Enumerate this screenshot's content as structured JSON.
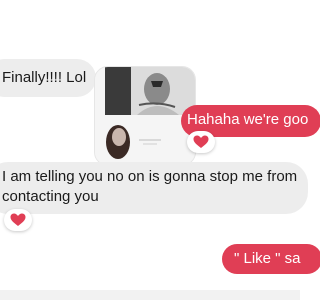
{
  "messages": {
    "m1": "Finally!!!! Lol",
    "m2": "Hahaha we're goo",
    "m3": "I am telling you no on is gonna stop me from contacting you",
    "m4": "\" Like \" sa"
  },
  "reaction_icon": "heart-icon",
  "colors": {
    "incoming_bubble": "#ededed",
    "outgoing_bubble": "#e03e55",
    "heart": "#e03e55"
  }
}
